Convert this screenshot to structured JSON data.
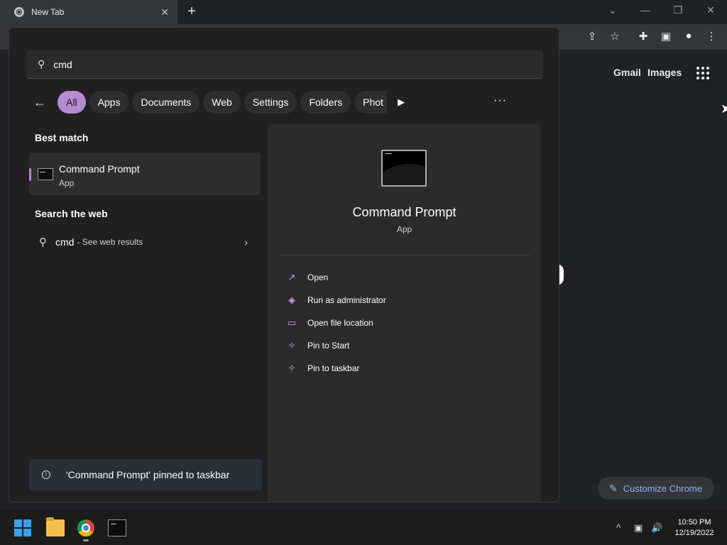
{
  "browser": {
    "tab_title": "New Tab",
    "tab_close": "✕",
    "new_tab": "+",
    "minimize": "—",
    "restore": "❐",
    "close": "✕",
    "tab_search": "⌄",
    "toolbar_icons": {
      "share": "⇪",
      "star": "☆",
      "extensions": "✚",
      "sidepanel": "▣",
      "profile": "●",
      "menu": "⋮"
    },
    "ntp_links": {
      "gmail": "Gmail",
      "images": "Images"
    },
    "customize_label": "Customize Chrome",
    "customize_icon": "✎"
  },
  "start_search": {
    "query": "cmd",
    "search_icon": "⚲",
    "back_icon": "←",
    "filters": [
      "All",
      "Apps",
      "Documents",
      "Web",
      "Settings",
      "Folders",
      "Phot"
    ],
    "active_filter": "All",
    "more_filters": "▶",
    "more_options": "···",
    "best_match_title": "Best match",
    "best_match": {
      "name": "Command Prompt",
      "type": "App"
    },
    "web_section_title": "Search the web",
    "web_result": {
      "query": "cmd",
      "hint": "- See web results",
      "chevron": "›"
    },
    "toast": {
      "icon": "i",
      "text": "'Command Prompt' pinned to taskbar"
    },
    "accent_color": "#b58bd2"
  },
  "detail_panel": {
    "title": "Command Prompt",
    "subtitle": "App",
    "actions": [
      {
        "label": "Open",
        "icon": "↗"
      },
      {
        "label": "Run as administrator",
        "icon": "◈"
      },
      {
        "label": "Open file location",
        "icon": "▭"
      },
      {
        "label": "Pin to Start",
        "icon": "✧"
      },
      {
        "label": "Pin to taskbar",
        "icon": "✧"
      }
    ]
  },
  "taskbar": {
    "apps": [
      "Start",
      "File Explorer",
      "Google Chrome",
      "Command Prompt"
    ],
    "tray": {
      "chevron": "^",
      "network": "▣",
      "volume": "🔊"
    },
    "time": "10:50 PM",
    "date": "12/19/2022"
  }
}
